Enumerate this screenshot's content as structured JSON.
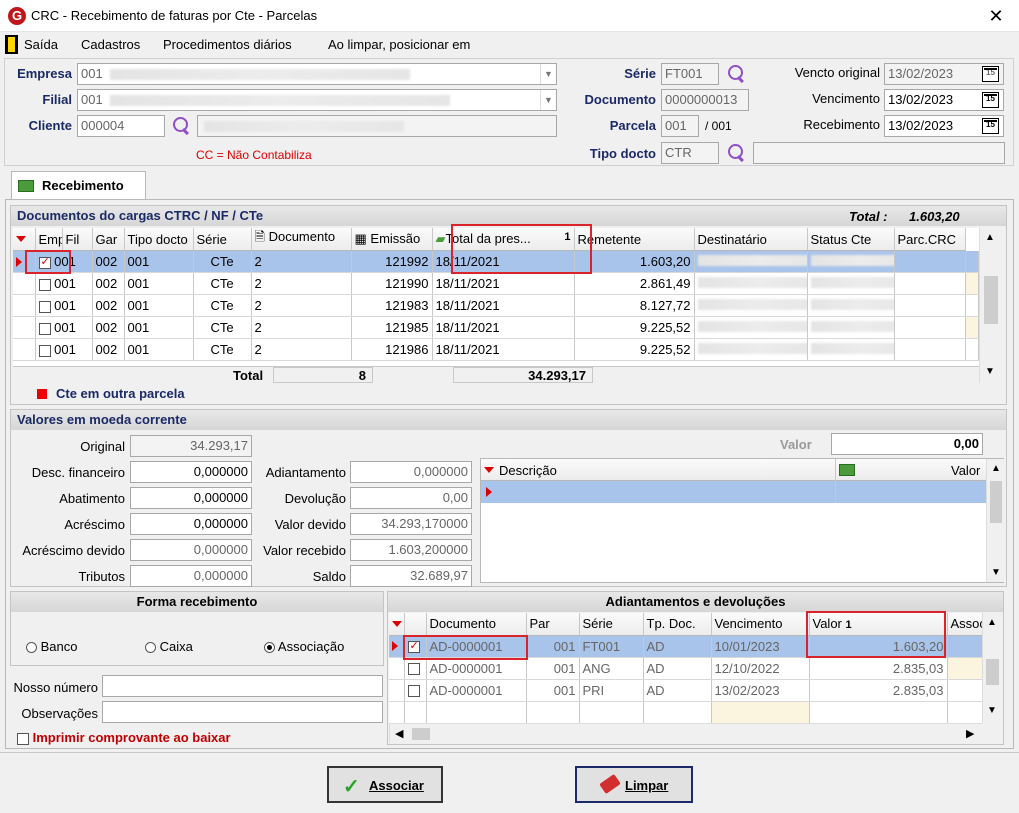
{
  "window": {
    "title": "CRC - Recebimento de faturas por Cte - Parcelas",
    "close_glyph": "✕"
  },
  "menu": [
    "Saída",
    "Cadastros",
    "Procedimentos diários",
    "Ao limpar, posicionar em"
  ],
  "header": {
    "empresa_label": "Empresa",
    "empresa_value": "001",
    "filial_label": "Filial",
    "filial_value": "001",
    "cliente_label": "Cliente",
    "cliente_value": "000004",
    "cc_note": "CC = Não Contabiliza",
    "serie_label": "Série",
    "serie_value": "FT001",
    "documento_label": "Documento",
    "documento_value": "0000000013",
    "parcela_label": "Parcela",
    "parcela_value": "001",
    "parcela_total": "/ 001",
    "tipo_docto_label": "Tipo docto",
    "tipo_docto_value": "CTR",
    "vencto_original_label": "Vencto original",
    "vencto_original_value": "13/02/2023",
    "vencimento_label": "Vencimento",
    "vencimento_value": "13/02/2023",
    "recebimento_label": "Recebimento",
    "recebimento_value": "13/02/2023",
    "cal_glyph": "15"
  },
  "tab": {
    "label": "Recebimento"
  },
  "docs": {
    "title": "Documentos do cargas CTRC / NF / CTe",
    "total_label": "Total :",
    "total_value": "1.603,20",
    "columns": [
      "Emp",
      "Fil",
      "Gar",
      "Tipo docto",
      "Série",
      "Documento",
      "Emissão",
      "Total da pres...",
      "Remetente",
      "Destinatário",
      "Status Cte",
      "Parc.CRC"
    ],
    "rows": [
      {
        "emp": "001",
        "fil": "002",
        "gar": "001",
        "tipo": "CTe",
        "serie": "2",
        "doc": "121992",
        "emissao": "18/11/2021",
        "total": "1.603,20"
      },
      {
        "emp": "001",
        "fil": "002",
        "gar": "001",
        "tipo": "CTe",
        "serie": "2",
        "doc": "121990",
        "emissao": "18/11/2021",
        "total": "2.861,49"
      },
      {
        "emp": "001",
        "fil": "002",
        "gar": "001",
        "tipo": "CTe",
        "serie": "2",
        "doc": "121983",
        "emissao": "18/11/2021",
        "total": "8.127,72"
      },
      {
        "emp": "001",
        "fil": "002",
        "gar": "001",
        "tipo": "CTe",
        "serie": "2",
        "doc": "121985",
        "emissao": "18/11/2021",
        "total": "9.225,52"
      },
      {
        "emp": "001",
        "fil": "002",
        "gar": "001",
        "tipo": "CTe",
        "serie": "2",
        "doc": "121986",
        "emissao": "18/11/2021",
        "total": "9.225,52"
      }
    ],
    "footer_total_label": "Total",
    "footer_count": "8",
    "footer_sum": "34.293,17",
    "legend": "Cte em outra parcela",
    "sort_badge": "1"
  },
  "valores": {
    "title": "Valores em moeda corrente",
    "original_label": "Original",
    "original_value": "34.293,17",
    "desc_label": "Desc. financeiro",
    "desc_value": "0,000000",
    "abat_label": "Abatimento",
    "abat_value": "0,000000",
    "acresc_label": "Acréscimo",
    "acresc_value": "0,000000",
    "acresc_dev_label": "Acréscimo devido",
    "acresc_dev_value": "0,000000",
    "tributos_label": "Tributos",
    "tributos_value": "0,000000",
    "adiant_label": "Adiantamento",
    "adiant_value": "0,000000",
    "devol_label": "Devolução",
    "devol_value": "0,00",
    "vdevido_label": "Valor devido",
    "vdevido_value": "34.293,170000",
    "vrecebido_label": "Valor recebido",
    "vrecebido_value": "1.603,200000",
    "saldo_label": "Saldo",
    "saldo_value": "32.689,97",
    "valor_label": "Valor",
    "valor_value": "0,00",
    "desc_col": "Descrição",
    "valor_col": "Valor"
  },
  "forma": {
    "title": "Forma recebimento",
    "banco": "Banco",
    "caixa": "Caixa",
    "associacao": "Associação",
    "nosso_label": "Nosso número",
    "obs_label": "Observações",
    "imprimir_label": "Imprimir comprovante ao baixar"
  },
  "adiant": {
    "title": "Adiantamentos e devoluções",
    "columns": [
      "Documento",
      "Par",
      "Série",
      "Tp. Doc.",
      "Vencimento",
      "Valor",
      "Assoc"
    ],
    "rows": [
      {
        "doc": "AD-0000001",
        "par": "001",
        "serie": "FT001",
        "tp": "AD",
        "venc": "10/01/2023",
        "valor": "1.603,20"
      },
      {
        "doc": "AD-0000001",
        "par": "001",
        "serie": "ANG",
        "tp": "AD",
        "venc": "12/10/2022",
        "valor": "2.835,03"
      },
      {
        "doc": "AD-0000001",
        "par": "001",
        "serie": "PRI",
        "tp": "AD",
        "venc": "13/02/2023",
        "valor": "2.835,03"
      }
    ],
    "sort_badge": "1"
  },
  "buttons": {
    "associar": "Associar",
    "limpar": "Limpar"
  },
  "colors": {
    "accent": "#1b2a66",
    "red": "#d8242a",
    "selected": "#a9c4ea"
  }
}
